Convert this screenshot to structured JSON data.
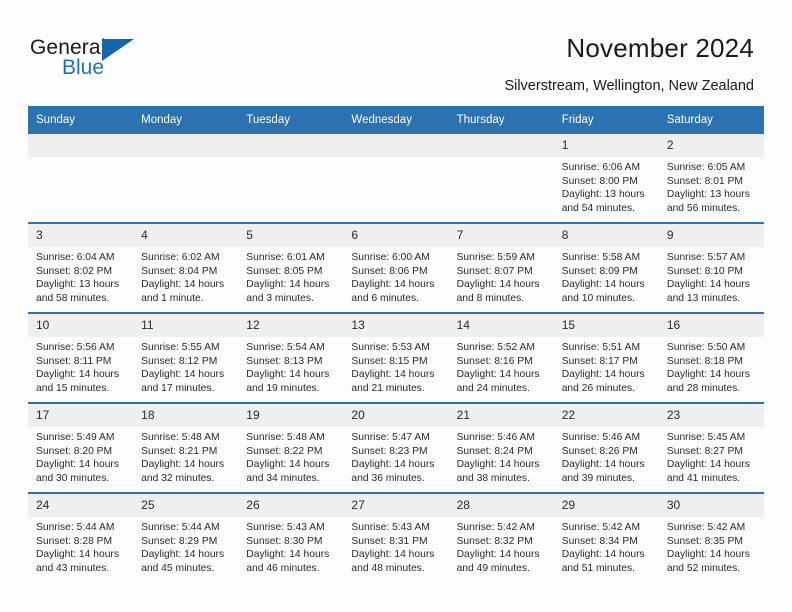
{
  "brand": {
    "name_part1": "General",
    "name_part2": "Blue",
    "triangle_color": "#1565ac",
    "blue_text_color": "#2271b3"
  },
  "header": {
    "title": "November 2024",
    "subtitle": "Silverstream, Wellington, New Zealand"
  },
  "theme": {
    "header_bar_color": "#2c72b0",
    "day_band_color": "#efefef",
    "page_background": "#fdfdfd"
  },
  "weekday_headers": [
    "Sunday",
    "Monday",
    "Tuesday",
    "Wednesday",
    "Thursday",
    "Friday",
    "Saturday"
  ],
  "weeks": [
    [
      {
        "day": "",
        "empty": true,
        "sunrise": "",
        "sunset": "",
        "daylight_line1": "",
        "daylight_line2": ""
      },
      {
        "day": "",
        "empty": true,
        "sunrise": "",
        "sunset": "",
        "daylight_line1": "",
        "daylight_line2": ""
      },
      {
        "day": "",
        "empty": true,
        "sunrise": "",
        "sunset": "",
        "daylight_line1": "",
        "daylight_line2": ""
      },
      {
        "day": "",
        "empty": true,
        "sunrise": "",
        "sunset": "",
        "daylight_line1": "",
        "daylight_line2": ""
      },
      {
        "day": "",
        "empty": true,
        "sunrise": "",
        "sunset": "",
        "daylight_line1": "",
        "daylight_line2": ""
      },
      {
        "day": "1",
        "empty": false,
        "sunrise": "Sunrise: 6:06 AM",
        "sunset": "Sunset: 8:00 PM",
        "daylight_line1": "Daylight: 13 hours",
        "daylight_line2": "and 54 minutes."
      },
      {
        "day": "2",
        "empty": false,
        "sunrise": "Sunrise: 6:05 AM",
        "sunset": "Sunset: 8:01 PM",
        "daylight_line1": "Daylight: 13 hours",
        "daylight_line2": "and 56 minutes."
      }
    ],
    [
      {
        "day": "3",
        "empty": false,
        "sunrise": "Sunrise: 6:04 AM",
        "sunset": "Sunset: 8:02 PM",
        "daylight_line1": "Daylight: 13 hours",
        "daylight_line2": "and 58 minutes."
      },
      {
        "day": "4",
        "empty": false,
        "sunrise": "Sunrise: 6:02 AM",
        "sunset": "Sunset: 8:04 PM",
        "daylight_line1": "Daylight: 14 hours",
        "daylight_line2": "and 1 minute."
      },
      {
        "day": "5",
        "empty": false,
        "sunrise": "Sunrise: 6:01 AM",
        "sunset": "Sunset: 8:05 PM",
        "daylight_line1": "Daylight: 14 hours",
        "daylight_line2": "and 3 minutes."
      },
      {
        "day": "6",
        "empty": false,
        "sunrise": "Sunrise: 6:00 AM",
        "sunset": "Sunset: 8:06 PM",
        "daylight_line1": "Daylight: 14 hours",
        "daylight_line2": "and 6 minutes."
      },
      {
        "day": "7",
        "empty": false,
        "sunrise": "Sunrise: 5:59 AM",
        "sunset": "Sunset: 8:07 PM",
        "daylight_line1": "Daylight: 14 hours",
        "daylight_line2": "and 8 minutes."
      },
      {
        "day": "8",
        "empty": false,
        "sunrise": "Sunrise: 5:58 AM",
        "sunset": "Sunset: 8:09 PM",
        "daylight_line1": "Daylight: 14 hours",
        "daylight_line2": "and 10 minutes."
      },
      {
        "day": "9",
        "empty": false,
        "sunrise": "Sunrise: 5:57 AM",
        "sunset": "Sunset: 8:10 PM",
        "daylight_line1": "Daylight: 14 hours",
        "daylight_line2": "and 13 minutes."
      }
    ],
    [
      {
        "day": "10",
        "empty": false,
        "sunrise": "Sunrise: 5:56 AM",
        "sunset": "Sunset: 8:11 PM",
        "daylight_line1": "Daylight: 14 hours",
        "daylight_line2": "and 15 minutes."
      },
      {
        "day": "11",
        "empty": false,
        "sunrise": "Sunrise: 5:55 AM",
        "sunset": "Sunset: 8:12 PM",
        "daylight_line1": "Daylight: 14 hours",
        "daylight_line2": "and 17 minutes."
      },
      {
        "day": "12",
        "empty": false,
        "sunrise": "Sunrise: 5:54 AM",
        "sunset": "Sunset: 8:13 PM",
        "daylight_line1": "Daylight: 14 hours",
        "daylight_line2": "and 19 minutes."
      },
      {
        "day": "13",
        "empty": false,
        "sunrise": "Sunrise: 5:53 AM",
        "sunset": "Sunset: 8:15 PM",
        "daylight_line1": "Daylight: 14 hours",
        "daylight_line2": "and 21 minutes."
      },
      {
        "day": "14",
        "empty": false,
        "sunrise": "Sunrise: 5:52 AM",
        "sunset": "Sunset: 8:16 PM",
        "daylight_line1": "Daylight: 14 hours",
        "daylight_line2": "and 24 minutes."
      },
      {
        "day": "15",
        "empty": false,
        "sunrise": "Sunrise: 5:51 AM",
        "sunset": "Sunset: 8:17 PM",
        "daylight_line1": "Daylight: 14 hours",
        "daylight_line2": "and 26 minutes."
      },
      {
        "day": "16",
        "empty": false,
        "sunrise": "Sunrise: 5:50 AM",
        "sunset": "Sunset: 8:18 PM",
        "daylight_line1": "Daylight: 14 hours",
        "daylight_line2": "and 28 minutes."
      }
    ],
    [
      {
        "day": "17",
        "empty": false,
        "sunrise": "Sunrise: 5:49 AM",
        "sunset": "Sunset: 8:20 PM",
        "daylight_line1": "Daylight: 14 hours",
        "daylight_line2": "and 30 minutes."
      },
      {
        "day": "18",
        "empty": false,
        "sunrise": "Sunrise: 5:48 AM",
        "sunset": "Sunset: 8:21 PM",
        "daylight_line1": "Daylight: 14 hours",
        "daylight_line2": "and 32 minutes."
      },
      {
        "day": "19",
        "empty": false,
        "sunrise": "Sunrise: 5:48 AM",
        "sunset": "Sunset: 8:22 PM",
        "daylight_line1": "Daylight: 14 hours",
        "daylight_line2": "and 34 minutes."
      },
      {
        "day": "20",
        "empty": false,
        "sunrise": "Sunrise: 5:47 AM",
        "sunset": "Sunset: 8:23 PM",
        "daylight_line1": "Daylight: 14 hours",
        "daylight_line2": "and 36 minutes."
      },
      {
        "day": "21",
        "empty": false,
        "sunrise": "Sunrise: 5:46 AM",
        "sunset": "Sunset: 8:24 PM",
        "daylight_line1": "Daylight: 14 hours",
        "daylight_line2": "and 38 minutes."
      },
      {
        "day": "22",
        "empty": false,
        "sunrise": "Sunrise: 5:46 AM",
        "sunset": "Sunset: 8:26 PM",
        "daylight_line1": "Daylight: 14 hours",
        "daylight_line2": "and 39 minutes."
      },
      {
        "day": "23",
        "empty": false,
        "sunrise": "Sunrise: 5:45 AM",
        "sunset": "Sunset: 8:27 PM",
        "daylight_line1": "Daylight: 14 hours",
        "daylight_line2": "and 41 minutes."
      }
    ],
    [
      {
        "day": "24",
        "empty": false,
        "sunrise": "Sunrise: 5:44 AM",
        "sunset": "Sunset: 8:28 PM",
        "daylight_line1": "Daylight: 14 hours",
        "daylight_line2": "and 43 minutes."
      },
      {
        "day": "25",
        "empty": false,
        "sunrise": "Sunrise: 5:44 AM",
        "sunset": "Sunset: 8:29 PM",
        "daylight_line1": "Daylight: 14 hours",
        "daylight_line2": "and 45 minutes."
      },
      {
        "day": "26",
        "empty": false,
        "sunrise": "Sunrise: 5:43 AM",
        "sunset": "Sunset: 8:30 PM",
        "daylight_line1": "Daylight: 14 hours",
        "daylight_line2": "and 46 minutes."
      },
      {
        "day": "27",
        "empty": false,
        "sunrise": "Sunrise: 5:43 AM",
        "sunset": "Sunset: 8:31 PM",
        "daylight_line1": "Daylight: 14 hours",
        "daylight_line2": "and 48 minutes."
      },
      {
        "day": "28",
        "empty": false,
        "sunrise": "Sunrise: 5:42 AM",
        "sunset": "Sunset: 8:32 PM",
        "daylight_line1": "Daylight: 14 hours",
        "daylight_line2": "and 49 minutes."
      },
      {
        "day": "29",
        "empty": false,
        "sunrise": "Sunrise: 5:42 AM",
        "sunset": "Sunset: 8:34 PM",
        "daylight_line1": "Daylight: 14 hours",
        "daylight_line2": "and 51 minutes."
      },
      {
        "day": "30",
        "empty": false,
        "sunrise": "Sunrise: 5:42 AM",
        "sunset": "Sunset: 8:35 PM",
        "daylight_line1": "Daylight: 14 hours",
        "daylight_line2": "and 52 minutes."
      }
    ]
  ]
}
